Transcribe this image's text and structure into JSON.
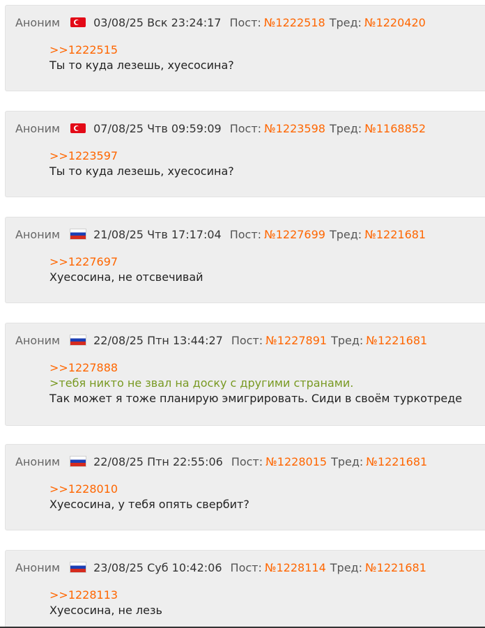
{
  "posts": [
    {
      "author": "Аноним",
      "flag": "tr-flag",
      "date": "03/08/25 Вск 23:24:17",
      "post_label": "Пост:",
      "post_num": "№1222518",
      "thread_label": "Тред:",
      "thread_num": "№1220420",
      "reply": ">>1222515",
      "quote": "",
      "text": "Ты то куда лезешь, хуесосина?"
    },
    {
      "author": "Аноним",
      "flag": "tr-flag",
      "date": "07/08/25 Чтв 09:59:09",
      "post_label": "Пост:",
      "post_num": "№1223598",
      "thread_label": "Тред:",
      "thread_num": "№1168852",
      "reply": ">>1223597",
      "quote": "",
      "text": "Ты то куда лезешь, хуесосина?"
    },
    {
      "author": "Аноним",
      "flag": "ru-flag",
      "date": "21/08/25 Чтв 17:17:04",
      "post_label": "Пост:",
      "post_num": "№1227699",
      "thread_label": "Тред:",
      "thread_num": "№1221681",
      "reply": ">>1227697",
      "quote": "",
      "text": "Хуесосина, не отсвечивай"
    },
    {
      "author": "Аноним",
      "flag": "ru-flag",
      "date": "22/08/25 Птн 13:44:27",
      "post_label": "Пост:",
      "post_num": "№1227891",
      "thread_label": "Тред:",
      "thread_num": "№1221681",
      "reply": ">>1227888",
      "quote": ">тебя никто не звал на доску с другими странами.",
      "text": "Так может я тоже планирую эмигрировать. Сиди в своём туркотреде"
    },
    {
      "author": "Аноним",
      "flag": "ru-flag",
      "date": "22/08/25 Птн 22:55:06",
      "post_label": "Пост:",
      "post_num": "№1228015",
      "thread_label": "Тред:",
      "thread_num": "№1221681",
      "reply": ">>1228010",
      "quote": "",
      "text": "Хуесосина, у тебя опять свербит?"
    },
    {
      "author": "Аноним",
      "flag": "ru-flag",
      "date": "23/08/25 Суб 10:42:06",
      "post_label": "Пост:",
      "post_num": "№1228114",
      "thread_label": "Тред:",
      "thread_num": "№1221681",
      "reply": ">>1228113",
      "quote": "",
      "text": "Хуесосина, не лезь"
    }
  ]
}
